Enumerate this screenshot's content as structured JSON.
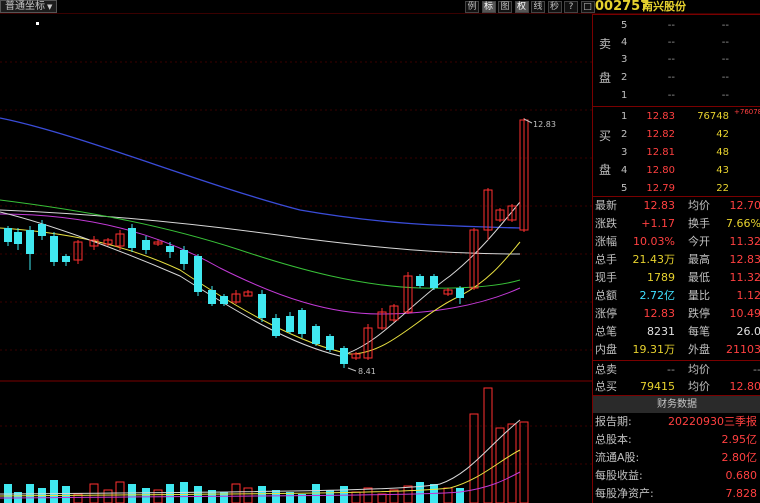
{
  "toolbar": {
    "mode_label": "普通坐标",
    "buttons": [
      {
        "label": "例",
        "active": false
      },
      {
        "label": "标",
        "active": true
      },
      {
        "label": "图",
        "active": false
      },
      {
        "label": "权",
        "active": true
      },
      {
        "label": "线",
        "active": false
      },
      {
        "label": "秒",
        "active": false
      },
      {
        "label": "?",
        "active": false
      },
      {
        "label": "□",
        "active": false
      }
    ]
  },
  "stock": {
    "code": "002757",
    "name": "南兴股份"
  },
  "chart": {
    "high_label": "12.83",
    "low_label": "8.41",
    "colors": {
      "up": "#ff3030",
      "down": "#40e8f0",
      "ma_blue": "#3a4cd8",
      "ma_purple": "#c23ad6",
      "ma_green": "#38c038",
      "ma_white": "#d8d8d8",
      "ma_yellow": "#e8e040"
    }
  },
  "order_book": {
    "sell_label_1": "卖",
    "sell_label_2": "盘",
    "buy_label_1": "买",
    "buy_label_2": "盘",
    "asks": [
      {
        "level": "5",
        "price": "--",
        "volume": "--"
      },
      {
        "level": "4",
        "price": "--",
        "volume": "--"
      },
      {
        "level": "3",
        "price": "--",
        "volume": "--"
      },
      {
        "level": "2",
        "price": "--",
        "volume": "--"
      },
      {
        "level": "1",
        "price": "--",
        "volume": "--"
      }
    ],
    "bids": [
      {
        "level": "1",
        "price": "12.83",
        "volume": "76748",
        "extra": "+76078"
      },
      {
        "level": "2",
        "price": "12.82",
        "volume": "42",
        "extra": ""
      },
      {
        "level": "3",
        "price": "12.81",
        "volume": "48",
        "extra": ""
      },
      {
        "level": "4",
        "price": "12.80",
        "volume": "43",
        "extra": ""
      },
      {
        "level": "5",
        "price": "12.79",
        "volume": "22",
        "extra": ""
      }
    ]
  },
  "stats": [
    {
      "k1": "最新",
      "v1": "12.83",
      "c1": "red",
      "k2": "均价",
      "v2": "12.70",
      "c2": "red"
    },
    {
      "k1": "涨跌",
      "v1": "+1.17",
      "c1": "red",
      "k2": "换手",
      "v2": "7.66%",
      "c2": "yellow"
    },
    {
      "k1": "涨幅",
      "v1": "10.03%",
      "c1": "red",
      "k2": "今开",
      "v2": "11.32",
      "c2": "red"
    },
    {
      "k1": "总手",
      "v1": "21.43万",
      "c1": "yellow",
      "k2": "最高",
      "v2": "12.83",
      "c2": "red"
    },
    {
      "k1": "现手",
      "v1": "1789",
      "c1": "yellow",
      "k2": "最低",
      "v2": "11.32",
      "c2": "red"
    },
    {
      "k1": "总额",
      "v1": "2.72亿",
      "c1": "cyan",
      "k2": "量比",
      "v2": "1.12",
      "c2": "red"
    },
    {
      "k1": "涨停",
      "v1": "12.83",
      "c1": "red",
      "k2": "跌停",
      "v2": "10.49",
      "c2": "red"
    },
    {
      "k1": "总笔",
      "v1": "8231",
      "c1": "white",
      "k2": "每笔",
      "v2": "26.0",
      "c2": "white"
    },
    {
      "k1": "内盘",
      "v1": "19.31万",
      "c1": "yellow",
      "k2": "外盘",
      "v2": "21103",
      "c2": "red"
    }
  ],
  "totals": [
    {
      "k1": "总卖",
      "v1": "--",
      "c1": "grey",
      "k2": "均价",
      "v2": "--",
      "c2": "grey"
    },
    {
      "k1": "总买",
      "v1": "79415",
      "c1": "yellow",
      "k2": "均价",
      "v2": "12.80",
      "c2": "red"
    }
  ],
  "financial": {
    "header": "财务数据",
    "rows": [
      {
        "key": "报告期:",
        "value": "20220930三季报"
      },
      {
        "key": "总股本:",
        "value": "2.95亿"
      },
      {
        "key": "流通A股:",
        "value": "2.80亿"
      },
      {
        "key": "每股收益:",
        "value": "0.680"
      },
      {
        "key": "每股净资产:",
        "value": "7.828"
      }
    ]
  }
}
